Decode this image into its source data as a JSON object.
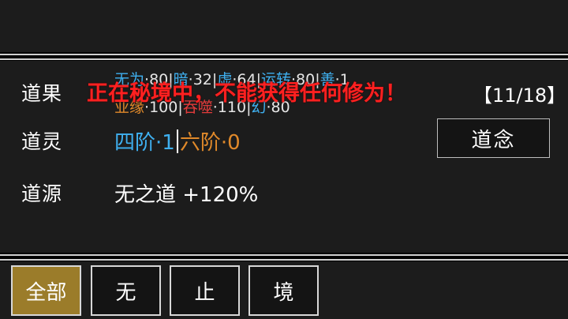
{
  "labels": {
    "daoguo": "道果",
    "daoling": "道灵",
    "daoyuan": "道源"
  },
  "stats": {
    "row1": [
      {
        "key": "无为",
        "value": "80"
      },
      {
        "key": "暗",
        "value": "32"
      },
      {
        "key": "虚",
        "value": "64"
      },
      {
        "key": "运转",
        "value": "80"
      },
      {
        "key": "善",
        "value": "1"
      }
    ],
    "row2": [
      {
        "key": "业缘",
        "value": "100"
      },
      {
        "key": "吞噬",
        "value": "110"
      },
      {
        "key": "幻",
        "value": "80"
      }
    ]
  },
  "warning": "正在秘境中，不能获得任何修为！",
  "counter": "【11/18】",
  "grade": {
    "tier1": "四阶·1",
    "tier2": "六阶·0"
  },
  "source": "无之道 +120%",
  "buttons": {
    "daonian": "道念"
  },
  "tabs": [
    {
      "label": "全部",
      "active": true
    },
    {
      "label": "无",
      "active": false
    },
    {
      "label": "止",
      "active": false
    },
    {
      "label": "境",
      "active": false
    }
  ],
  "colors": {
    "blue": "#3fb0f0",
    "orange": "#e0892a",
    "red": "#ff2020",
    "active_tab": "#9b7c2a"
  }
}
